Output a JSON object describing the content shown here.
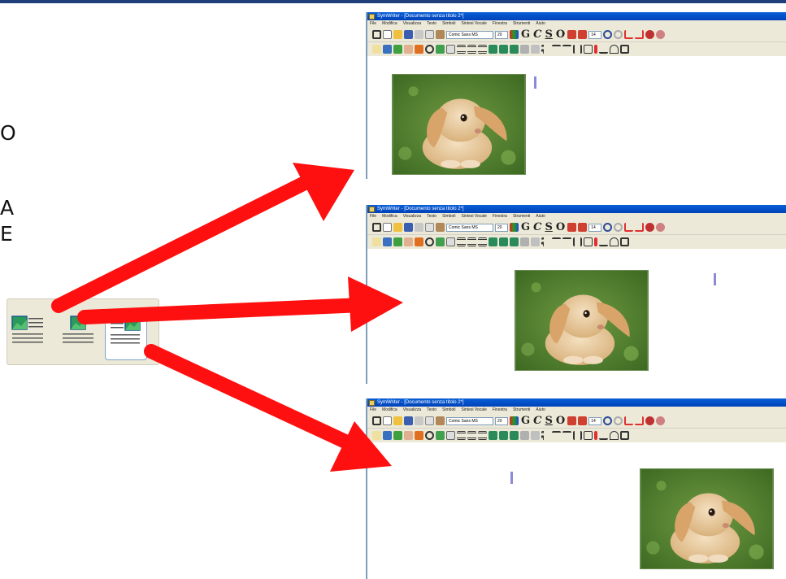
{
  "slide": {
    "side_fragments": [
      "O",
      "A",
      "E"
    ]
  },
  "app": {
    "title": "SymWriter - [Documento senza titolo 2*]",
    "menu": [
      "File",
      "Modifica",
      "Visualizza",
      "Testo",
      "Simboli",
      "Sintesi Vocale",
      "Finestra",
      "Strumenti",
      "Aiuto"
    ],
    "font_name": "Comic Sans MS",
    "font_size": "20",
    "symbol_size": "14",
    "format_letters": [
      "G",
      "C",
      "S",
      "O"
    ]
  },
  "panels": [
    {
      "alignment": "left"
    },
    {
      "alignment": "center"
    },
    {
      "alignment": "right"
    }
  ],
  "alignment_toolbar": {
    "buttons": [
      "image-left",
      "image-center",
      "image-right"
    ],
    "selected": "image-right"
  },
  "colors": {
    "arrow": "#ff1010",
    "titlebar": "#0a5fd8",
    "toolbar": "#ece9d8",
    "cursor": "#8a8ad8",
    "slide_bar": "#1f3f7a"
  }
}
